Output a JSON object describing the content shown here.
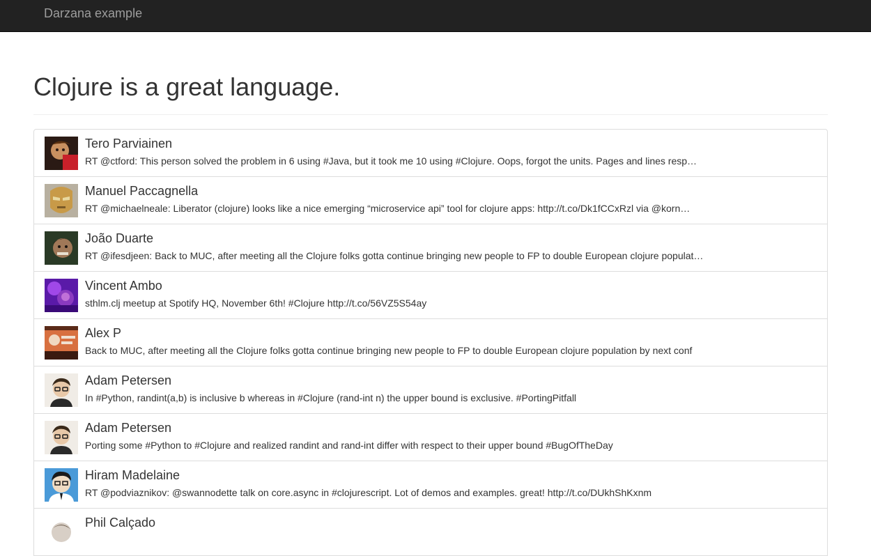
{
  "navbar": {
    "brand": "Darzana example"
  },
  "page": {
    "heading": "Clojure is a great language."
  },
  "tweets": [
    {
      "name": "Tero Parviainen",
      "text": "RT @ctford: This person solved the problem in 6 using #Java, but it took me 10 using #Clojure. Oops, forgot the units. Pages and lines resp…",
      "avatar_color": "#6b3a22"
    },
    {
      "name": "Manuel Paccagnella",
      "text": "RT @michaelneale: Liberator (clojure) looks like a nice emerging “microservice api” tool for clojure apps: http://t.co/Dk1fCCxRzl via @korn…",
      "avatar_color": "#8a7a64"
    },
    {
      "name": "João Duarte",
      "text": "RT @ifesdjeen: Back to MUC, after meeting all the Clojure folks gotta continue bringing new people to FP to double European clojure populat…",
      "avatar_color": "#3a4a36"
    },
    {
      "name": "Vincent Ambo",
      "text": "sthlm.clj meetup at Spotify HQ, November 6th! #Clojure http://t.co/56VZ5S54ay",
      "avatar_color": "#7a22c8"
    },
    {
      "name": "Alex P",
      "text": "Back to MUC, after meeting all the Clojure folks gotta continue bringing new people to FP to double European clojure population by next conf",
      "avatar_color": "#b8502e"
    },
    {
      "name": "Adam Petersen",
      "text": "In #Python, randint(a,b) is inclusive b whereas in #Clojure (rand-int n) the upper bound is exclusive. #PortingPitfall",
      "avatar_color": "#e8d8c8"
    },
    {
      "name": "Adam Petersen",
      "text": "Porting some #Python to #Clojure and realized randint and rand-int differ with respect to their upper bound #BugOfTheDay",
      "avatar_color": "#e8d8c8"
    },
    {
      "name": "Hiram Madelaine",
      "text": "RT @podviaznikov: @swannodette talk on core.async in #clojurescript. Lot of demos and examples. great! http://t.co/DUkhShKxnm",
      "avatar_color": "#4a9ad8"
    },
    {
      "name": "Phil Calçado",
      "text": "",
      "avatar_color": "#d8cfc6"
    }
  ]
}
